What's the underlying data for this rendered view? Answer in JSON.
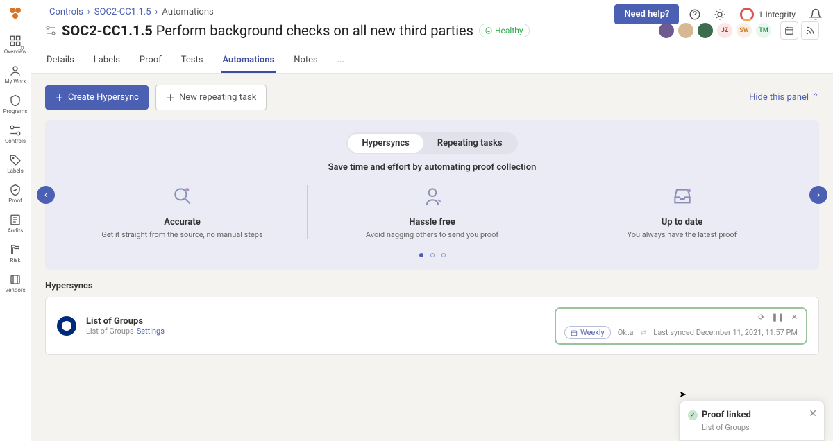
{
  "breadcrumb": {
    "root": "Controls",
    "mid": "SOC2-CC1.1.5",
    "current": "Automations"
  },
  "header": {
    "need_help": "Need help?",
    "org": "1-Integrity"
  },
  "title": {
    "code": "SOC2-CC1.1.5",
    "name": "Perform background checks on all new third parties",
    "status": "Healthy"
  },
  "avatars": [
    {
      "label": "",
      "bg": "#6e5b8f",
      "isImg": true
    },
    {
      "label": "",
      "bg": "#d6b895",
      "isImg": true
    },
    {
      "label": "",
      "bg": "#3a6c4d",
      "isImg": true
    },
    {
      "label": "JZ",
      "bg": "#fbe7e7",
      "fg": "#c0392b"
    },
    {
      "label": "SW",
      "bg": "#fbeee7",
      "fg": "#c7791c"
    },
    {
      "label": "TM",
      "bg": "#e7f7ee",
      "fg": "#2a8a55"
    }
  ],
  "tabs": [
    "Details",
    "Labels",
    "Proof",
    "Tests",
    "Automations",
    "Notes",
    "..."
  ],
  "active_tab": "Automations",
  "toolbar": {
    "create": "Create Hypersync",
    "repeat": "New repeating task",
    "hide": "Hide this panel"
  },
  "panel": {
    "tabs": [
      "Hypersyncs",
      "Repeating tasks"
    ],
    "sub": "Save time and effort by automating proof collection",
    "features": [
      {
        "title": "Accurate",
        "desc": "Get it straight from the source, no manual steps"
      },
      {
        "title": "Hassle free",
        "desc": "Avoid nagging others to send you proof"
      },
      {
        "title": "Up to date",
        "desc": "You always have the latest proof"
      }
    ]
  },
  "section": {
    "title": "Hypersyncs"
  },
  "sync": {
    "title": "List of Groups",
    "subtitle": "List of Groups",
    "settings": "Settings",
    "freq": "Weekly",
    "source": "Okta",
    "last": "Last synced December 11, 2021, 11:57 PM"
  },
  "sidebar": [
    "Overview",
    "My Work",
    "Programs",
    "Controls",
    "Labels",
    "Proof",
    "Audits",
    "Risk",
    "Vendors"
  ],
  "toast": {
    "title": "Proof linked",
    "sub": "List of Groups"
  }
}
